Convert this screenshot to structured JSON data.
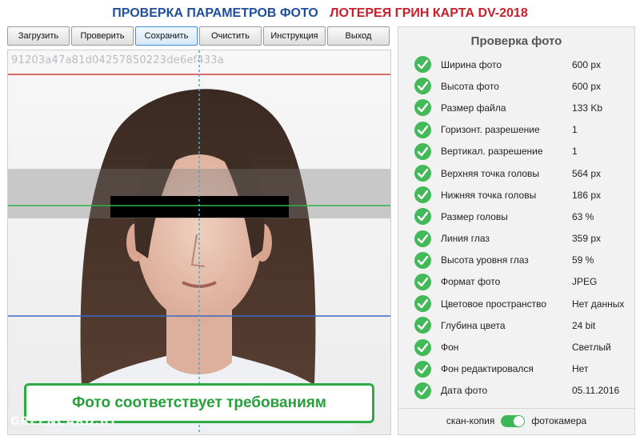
{
  "header": {
    "title_left": "ПРОВЕРКА ПАРАМЕТРОВ ФОТО",
    "title_right": "ЛОТЕРЕЯ ГРИН КАРТА DV-2018",
    "title_left_color": "#1f4e9b",
    "title_right_color": "#c8202b"
  },
  "toolbar": {
    "load": "Загрузить",
    "check": "Проверить",
    "save": "Сохранить",
    "clear": "Очистить",
    "instructions": "Инструкция",
    "exit": "Выход"
  },
  "photo": {
    "hash": "91203a47a81d04257850223de6ef433a",
    "status_message": "Фото соответствует требованиям",
    "watermark": "GREENCARD.BY"
  },
  "check_panel": {
    "title": "Проверка фото",
    "items": [
      {
        "label": "Ширина фото",
        "value": "600 px"
      },
      {
        "label": "Высота фото",
        "value": "600 px"
      },
      {
        "label": "Размер файла",
        "value": "133 Kb"
      },
      {
        "label": "Горизонт. разрешение",
        "value": "1"
      },
      {
        "label": "Вертикал. разрешение",
        "value": "1"
      },
      {
        "label": "Верхняя точка головы",
        "value": "564 px"
      },
      {
        "label": "Нижняя точка головы",
        "value": "186 px"
      },
      {
        "label": "Размер головы",
        "value": "63 %"
      },
      {
        "label": "Линия глаз",
        "value": "359 px"
      },
      {
        "label": "Высота уровня глаз",
        "value": "59 %"
      },
      {
        "label": "Формат фото",
        "value": "JPEG"
      },
      {
        "label": "Цветовое пространство",
        "value": "Нет данных"
      },
      {
        "label": "Глубина цвета",
        "value": "24 bit"
      },
      {
        "label": "Фон",
        "value": "Светлый"
      },
      {
        "label": "Фон редактировался",
        "value": "Нет"
      },
      {
        "label": "Дата фото",
        "value": "05.11.2016"
      }
    ],
    "mode_left": "скан-копия",
    "mode_right": "фотокамера",
    "mode_toggle_on": true
  },
  "colors": {
    "ok_green": "#43b95a",
    "status_green": "#2eaa44"
  }
}
